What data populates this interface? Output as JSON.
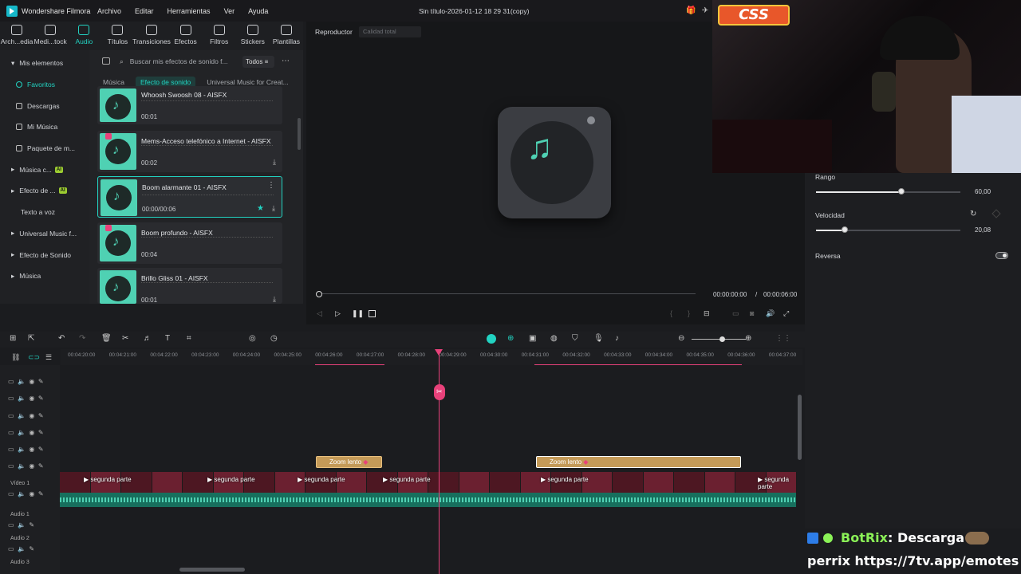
{
  "app": {
    "name": "Wondershare Filmora",
    "doc_title": "Sin título-2026-01-12 18 29 31(copy)"
  },
  "menu": [
    "Archivo",
    "Editar",
    "Herramientas",
    "Ver",
    "Ayuda"
  ],
  "toolbar": [
    "Arch...edia",
    "Medi...tock",
    "Audio",
    "Títulos",
    "Transiciones",
    "Efectos",
    "Filtros",
    "Stickers",
    "Plantillas"
  ],
  "sidebar": [
    {
      "label": "Mis elementos",
      "icon": "caret-down-icon"
    },
    {
      "label": "Favoritos",
      "icon": "star-icon"
    },
    {
      "label": "Descargas",
      "icon": "download-icon"
    },
    {
      "label": "Mi Música",
      "icon": "music-icon"
    },
    {
      "label": "Paquete de m...",
      "icon": "package-icon"
    },
    {
      "label": "Música c...",
      "icon": "caret-right-icon",
      "ai": "AI"
    },
    {
      "label": "Efecto de ...",
      "icon": "caret-right-icon",
      "ai": "AI"
    },
    {
      "label": "Texto a voz",
      "icon": ""
    },
    {
      "label": "Universal Music f...",
      "icon": "caret-right-icon"
    },
    {
      "label": "Efecto de Sonido",
      "icon": "caret-right-icon"
    },
    {
      "label": "Música",
      "icon": "caret-right-icon"
    }
  ],
  "library": {
    "search_placeholder": "Buscar mis efectos de sonido f...",
    "filter": "Todos",
    "tabs": [
      "Música",
      "Efecto de sonido",
      "Universal Music for Creat..."
    ],
    "items": [
      {
        "title": "Whoosh Swoosh 08 - AISFX",
        "duration": "00:01"
      },
      {
        "title": "Mems-Acceso telefónico a Internet - AISFX",
        "duration": "00:02"
      },
      {
        "title": "Boom alarmante 01 - AISFX",
        "duration": "00:00/00:06"
      },
      {
        "title": "Boom profundo - AISFX",
        "duration": "00:04"
      },
      {
        "title": "Brillo Gliss 01 - AISFX",
        "duration": "00:01"
      }
    ]
  },
  "player": {
    "label": "Reproductor",
    "quality": "Calidad total",
    "current": "00:00:00:00",
    "separator": "/",
    "total": "00:00:06:00"
  },
  "props": {
    "rango_label": "Rango",
    "rango_value": "60,00",
    "rango_fraction": 0.59,
    "velocidad_label": "Velocidad",
    "velocidad_value": "20,08",
    "velocidad_fraction": 0.2,
    "reversa_label": "Reversa"
  },
  "overlay": {
    "logo_text": "CSS"
  },
  "timeline": {
    "ruler": [
      "00:04:20:00",
      "00:04:21:00",
      "00:04:22:00",
      "00:04:23:00",
      "00:04:24:00",
      "00:04:25:00",
      "00:04:26:00",
      "00:04:27:00",
      "00:04:28:00",
      "00:04:29:00",
      "00:04:30:00",
      "00:04:31:00",
      "00:04:32:00",
      "00:04:33:00",
      "00:04:34:00",
      "00:04:35:00",
      "00:04:36:00",
      "00:04:37:00"
    ],
    "zoom_clip_label": "Zoom lento",
    "video_label": "Vídeo 1",
    "audio1": "Audio 1",
    "audio2": "Audio 2",
    "audio3": "Audio 3",
    "clip_name": "segunda parte"
  },
  "chat": {
    "user": "BotRix",
    "msg1": ": Descarga",
    "msg2": "perrix https://7tv.app/emotes"
  }
}
